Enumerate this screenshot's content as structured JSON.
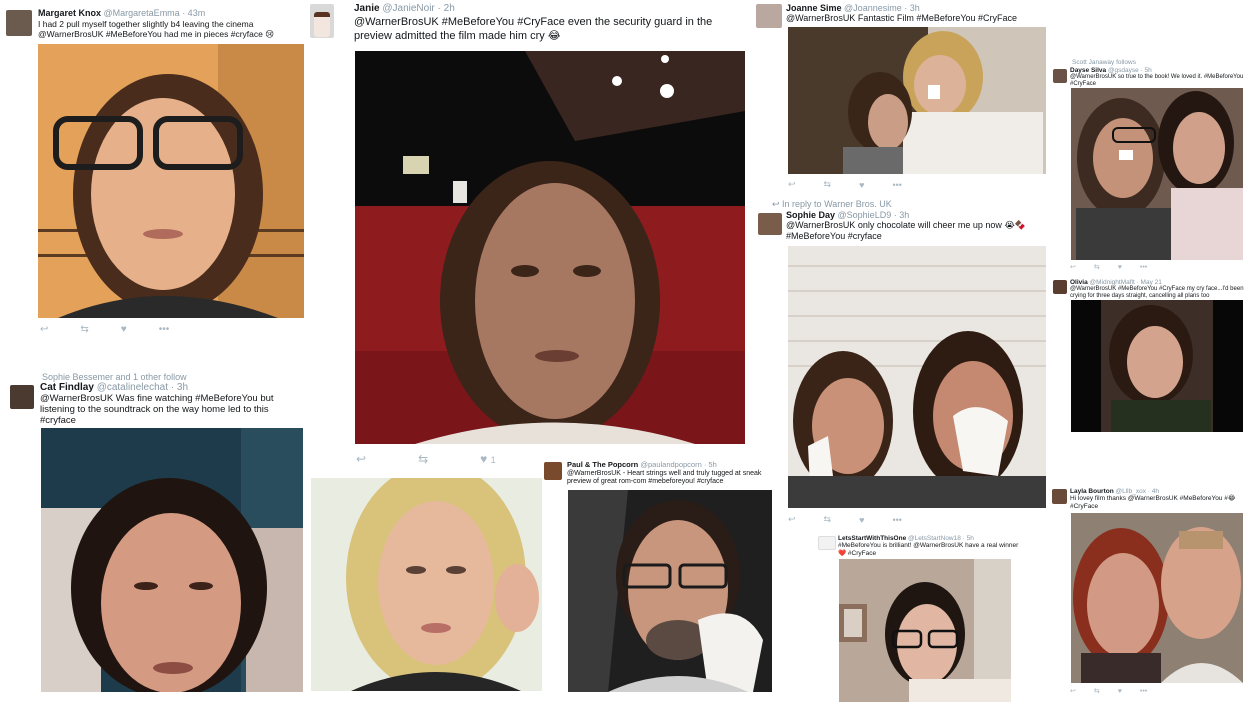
{
  "tweets": [
    {
      "name": "Margaret Knox",
      "handle": "@MargaretaEmma · 43m",
      "text": "I had 2 pull myself together slightly b4 leaving the cinema @WarnerBrosUK #MeBeforeYou had me in pieces #cryface 😢"
    },
    {
      "name": "Janie",
      "handle": "@JanieNoir · 2h",
      "text": "@WarnerBrosUK #MeBeforeYou #CryFace even the security guard in the preview admitted the film made him cry 😂",
      "likes": "1"
    },
    {
      "name": "Joanne Sime",
      "handle": "@Joannesime · 3h",
      "text": "@WarnerBrosUK Fantastic Film #MeBeforeYou #CryFace"
    },
    {
      "context": "Scott Janaway follows",
      "name": "Dayse Silva",
      "handle": "@gsdayse · 5h",
      "text": "@WarnerBrosUK so true to the book! We loved it. #MeBeforeYou #CryFace"
    },
    {
      "context": "In reply to Warner Bros. UK",
      "name": "Sophie Day",
      "handle": "@SophieLD9 · 3h",
      "text": "@WarnerBrosUK only chocolate will cheer me up now 😭🍫 #MeBeforeYou #cryface"
    },
    {
      "name": "Olivia",
      "handle": "@MidnightMaflt · May 21",
      "text": "@WarnerBrosUK #MeBeforeYou #CryFace my cry face...I'd been crying for three days straight, cancelling all plans too"
    },
    {
      "context": "Sophie Bessemer and 1 other follow",
      "name": "Cat Findlay",
      "handle": "@catalinelechat · 3h",
      "text": "@WarnerBrosUK Was fine watching #MeBeforeYou but listening to the soundtrack on the way home led to this #cryface"
    },
    {
      "name": "Paul & The Popcorn",
      "handle": "@paulandpopcorn · 5h",
      "text": "@WarnerBrosUK - Heart strings well and truly tugged at sneak preview of great rom-com #mebeforeyou! #cryface"
    },
    {
      "name": "LetsStartWithThisOne",
      "handle": "@LetsStartNow18 · 5h",
      "text": "#MeBeforeYou is brilliant! @WarnerBrosUK have a real winner ❤️ #CryFace"
    },
    {
      "name": "Layla Bourton",
      "handle": "@Lllb_xox · 4h",
      "text": "Hi lovey film thanks @WarnerBrosUK #MeBeforeYou #😂 #CryFace"
    }
  ],
  "icons": {
    "reply": "reply-icon",
    "retweet": "retweet-icon",
    "like": "heart-icon",
    "more": "more-icon"
  },
  "glyphs": {
    "reply": "↩",
    "retweet": "⇆",
    "like": "♥",
    "more": "•••"
  }
}
